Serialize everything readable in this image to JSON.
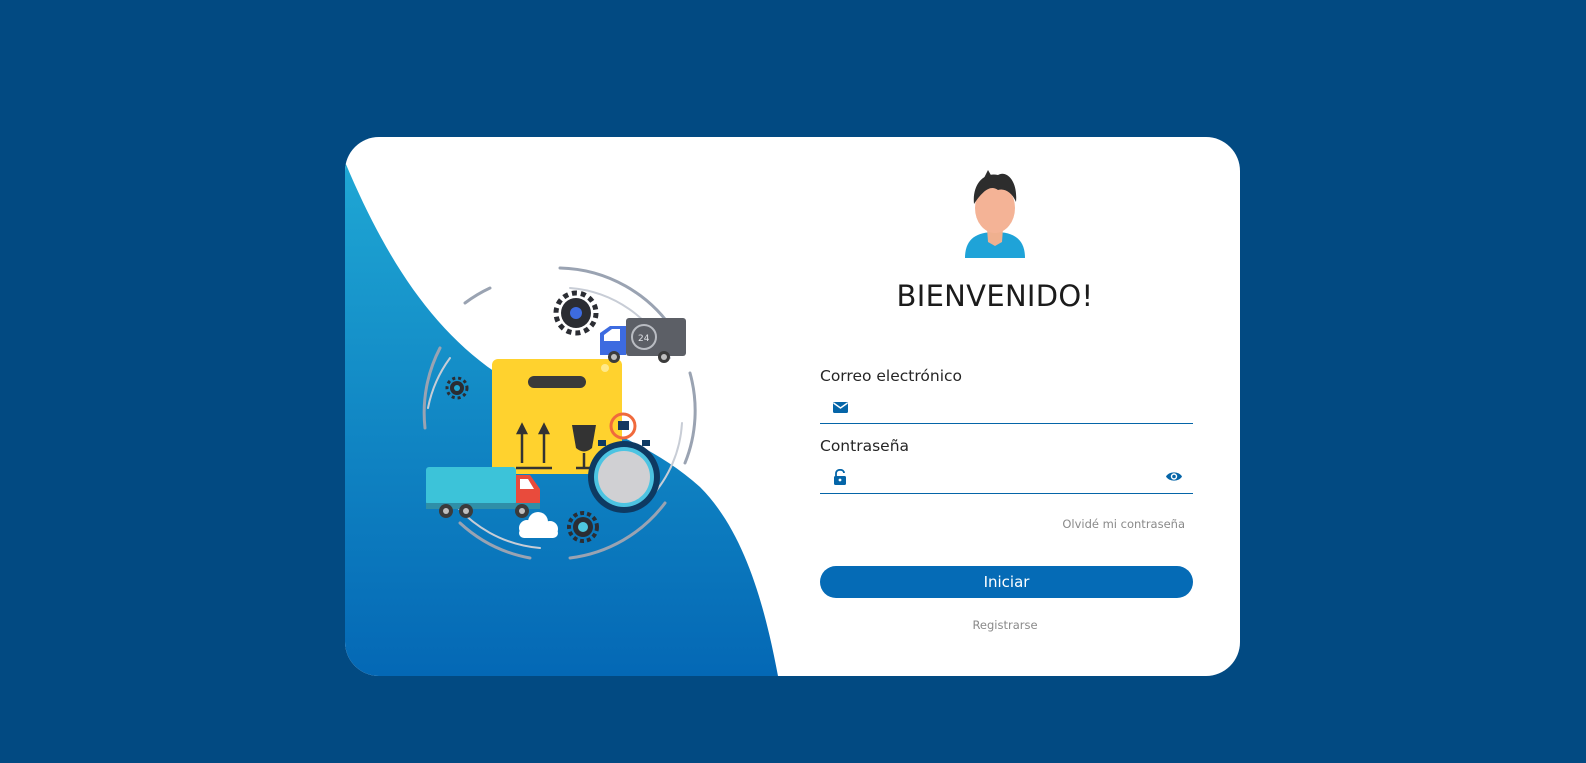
{
  "login": {
    "welcome_title": "BIENVENIDO!",
    "email": {
      "label": "Correo electrónico",
      "value": "",
      "placeholder": "",
      "icon": "envelope-icon"
    },
    "password": {
      "label": "Contraseña",
      "value": "",
      "placeholder": "",
      "icon": "unlock-icon",
      "toggle_icon": "eye-icon"
    },
    "forgot_password_label": "Olvidé mi contraseña",
    "submit_label": "Iniciar",
    "register_label": "Registrarse"
  },
  "colors": {
    "background": "#024a82",
    "accent": "#056bb6",
    "card": "#ffffff"
  }
}
